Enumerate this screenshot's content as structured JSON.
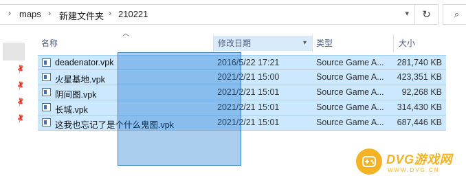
{
  "address_bar": {
    "breadcrumbs": [
      "maps",
      "新建文件夹",
      "210221"
    ],
    "separator": "›",
    "dropdown_icon": "chevron-down-icon",
    "refresh_icon": "refresh-icon",
    "search_icon": "search-icon"
  },
  "columns": {
    "name": "名称",
    "date": "修改日期",
    "type": "类型",
    "size": "大小"
  },
  "files": [
    {
      "name": "deadenator.vpk",
      "date": "2016/5/22 17:21",
      "type": "Source Game A...",
      "size": "281,740 KB"
    },
    {
      "name": "火星基地.vpk",
      "date": "2021/2/21 15:00",
      "type": "Source Game A...",
      "size": "423,351 KB"
    },
    {
      "name": "阴间图.vpk",
      "date": "2021/2/21 15:01",
      "type": "Source Game A...",
      "size": "92,268 KB"
    },
    {
      "name": "长城.vpk",
      "date": "2021/2/21 15:01",
      "type": "Source Game A...",
      "size": "314,430 KB"
    },
    {
      "name": "这我也忘记了是个什么鬼图.vpk",
      "date": "2021/2/21 15:01",
      "type": "Source Game A...",
      "size": "687,446 KB"
    }
  ],
  "watermark": {
    "title": "DVG游戏网",
    "subtitle": "WWW.DVG.CN"
  },
  "colors": {
    "selection": "#cce8ff",
    "selection_border": "#99d1ff",
    "marquee": "#3d7fc4",
    "watermark": "#f4b324"
  }
}
